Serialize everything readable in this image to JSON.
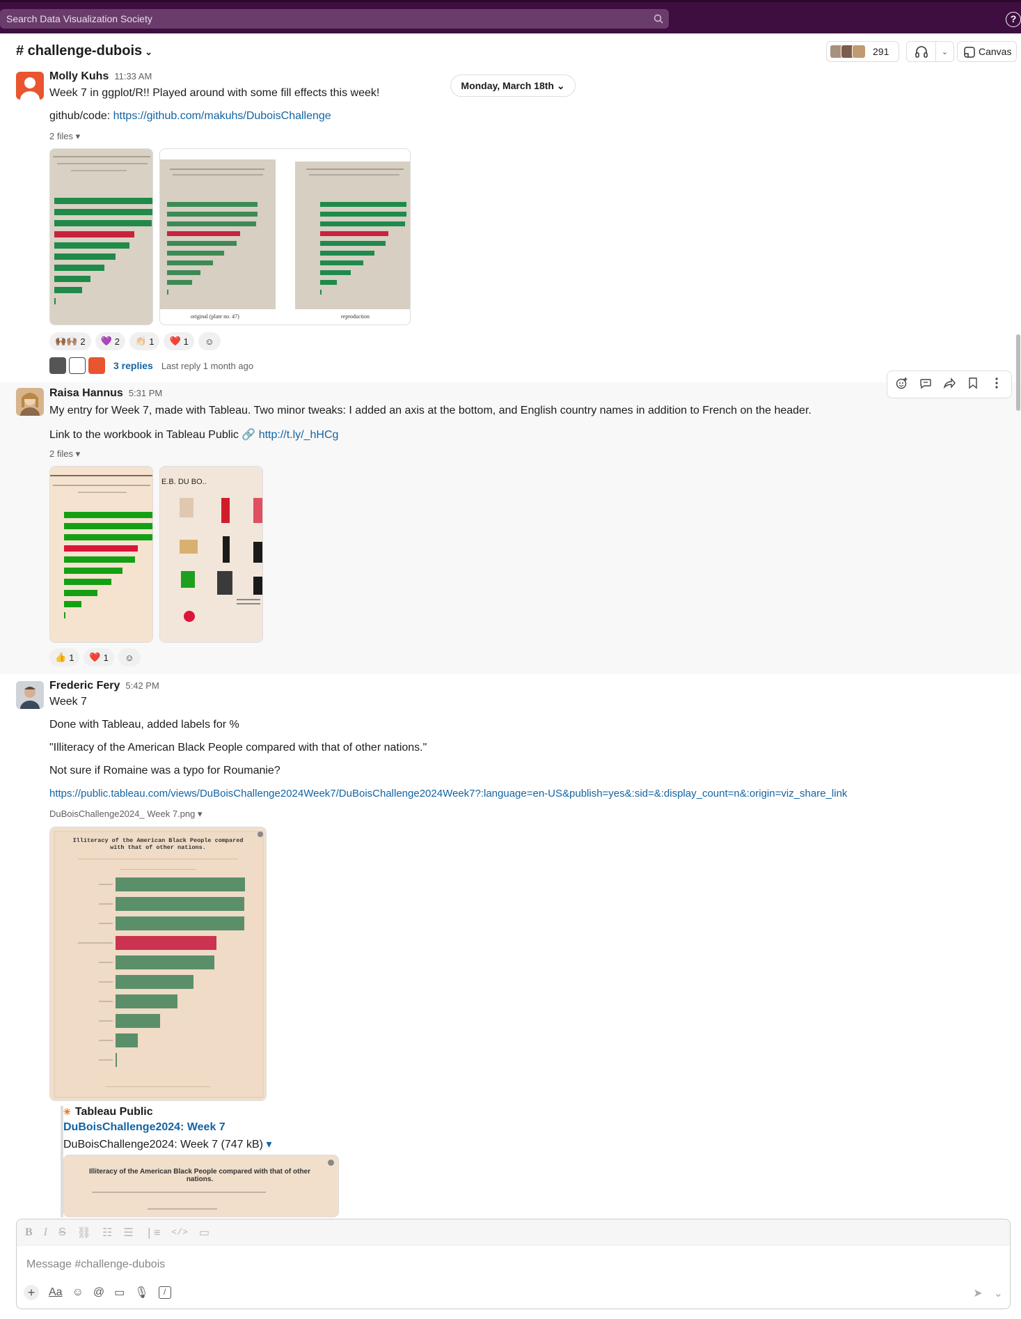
{
  "search": {
    "placeholder": "Search Data Visualization Society"
  },
  "help": {
    "label": "?"
  },
  "channel": {
    "name": "# challenge-dubois",
    "member_count": "291",
    "canvas_label": "Canvas"
  },
  "date_divider": "Monday, March 18th",
  "messages": [
    {
      "author": "Molly Kuhs",
      "time": "11:33 AM",
      "lines": [
        "Week 7 in ggplot/R!! Played around with some fill effects this week!"
      ],
      "link_prefix": "github/code: ",
      "link": "https://github.com/makuhs/DuboisChallenge",
      "files_label": "2 files",
      "captions": [
        "original (plate no. 47)",
        "reproduction"
      ],
      "reactions": [
        {
          "emoji": "🙌🏾🙌🏽",
          "count": "2"
        },
        {
          "emoji": "💜",
          "count": "2"
        },
        {
          "emoji": "👏🏻",
          "count": "1"
        },
        {
          "emoji": "❤️",
          "count": "1"
        }
      ],
      "replies": "3 replies",
      "last_reply": "Last reply 1 month ago"
    },
    {
      "author": "Raisa Hannus",
      "time": "5:31 PM",
      "lines": [
        "My entry for Week 7, made with Tableau. Two minor tweaks: I added an axis at the bottom, and English country names in addition to French on the header."
      ],
      "link_prefix": "Link to the workbook in Tableau Public 🔗 ",
      "link": "http://t.ly/_hHCg",
      "files_label": "2 files",
      "thumb_title": "E.B. DU BO..",
      "reactions": [
        {
          "emoji": "👍",
          "count": "1"
        },
        {
          "emoji": "❤️",
          "count": "1"
        }
      ]
    },
    {
      "author": "Frederic Fery",
      "time": "5:42 PM",
      "lines": [
        "Week 7",
        "Done with Tableau, added labels for %",
        "\"Illiteracy of the American Black People compared with that of other nations.\"",
        "Not sure if Romaine was a typo for Roumanie?"
      ],
      "link": "https://public.tableau.com/views/DuBoisChallenge2024Week7/DuBoisChallenge2024Week7?:language=en-US&publish=yes&:sid=&:display_count=n&:origin=viz_share_link",
      "file_name": "DuBoisChallenge2024_ Week 7.png",
      "image_title": "Illiteracy of the American Black People compared with that of other nations.",
      "unfurl": {
        "site": "Tableau Public",
        "title": "DuBoisChallenge2024: Week 7",
        "file": "DuBoisChallenge2024: Week 7 (747 kB)",
        "preview_title": "Illiteracy of the American Black People compared with that of other nations."
      }
    }
  ],
  "composer": {
    "placeholder": "Message #challenge-dubois"
  },
  "colors": {
    "aubergine": "#3f0e40",
    "link": "#1264a3",
    "green": "#0a8a2e",
    "red": "#c8102e",
    "dubois_green": "#5a8f6a",
    "dubois_red": "#cc3350"
  }
}
